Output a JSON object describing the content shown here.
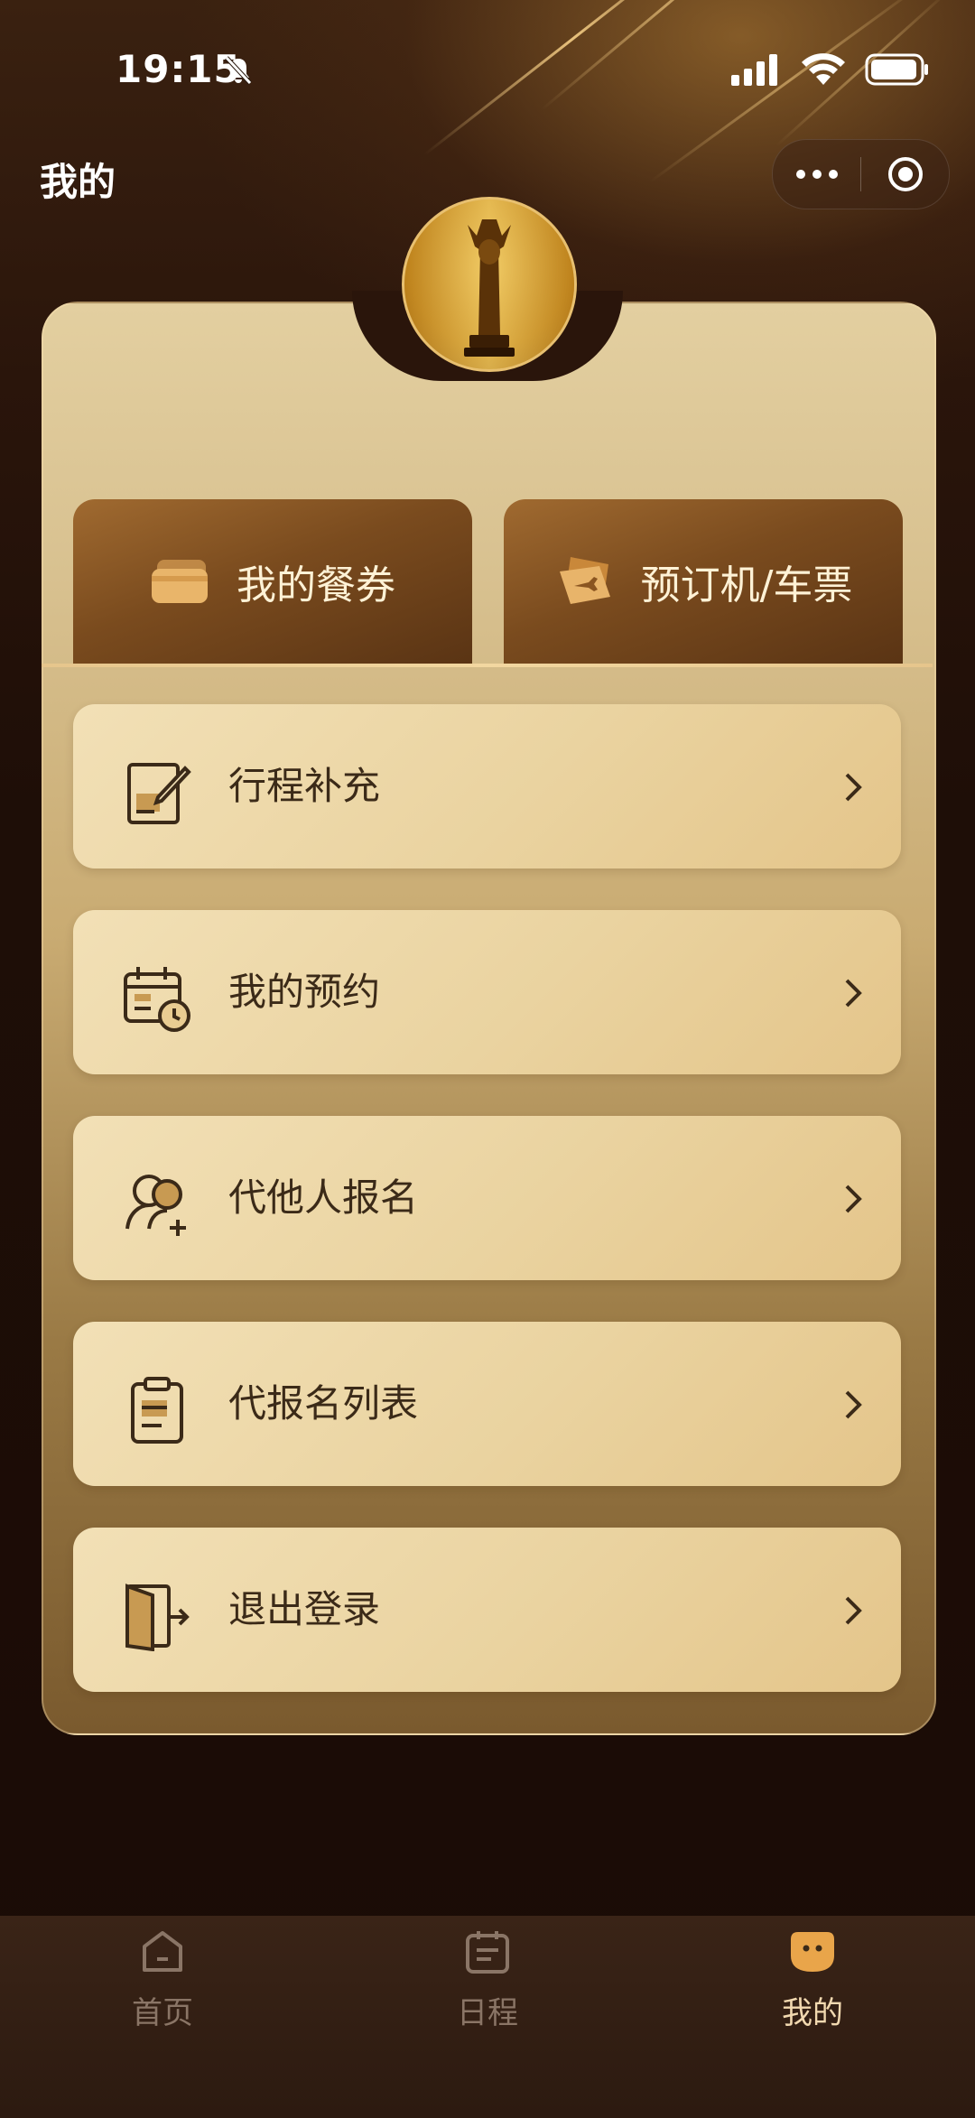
{
  "status_bar": {
    "time": "19:15"
  },
  "header": {
    "title": "我的"
  },
  "quick_actions": [
    {
      "label": "我的餐券",
      "icon": "meal-ticket-icon"
    },
    {
      "label": "预订机/车票",
      "icon": "ticket-icon"
    }
  ],
  "menu": [
    {
      "label": "行程补充",
      "icon": "edit-note-icon"
    },
    {
      "label": "我的预约",
      "icon": "calendar-clock-icon"
    },
    {
      "label": "代他人报名",
      "icon": "people-add-icon"
    },
    {
      "label": "代报名列表",
      "icon": "clipboard-icon"
    },
    {
      "label": "退出登录",
      "icon": "exit-door-icon"
    }
  ],
  "tabs": [
    {
      "label": "首页",
      "icon": "home-icon",
      "active": false
    },
    {
      "label": "日程",
      "icon": "calendar-icon",
      "active": false
    },
    {
      "label": "我的",
      "icon": "profile-icon",
      "active": true
    }
  ],
  "colors": {
    "card_gold": "#e3cfa0",
    "button_bronze": "#7a4b1e",
    "text_dark": "#3b2a18",
    "tab_inactive": "#8a7566",
    "tab_active": "#f2d9b0"
  }
}
